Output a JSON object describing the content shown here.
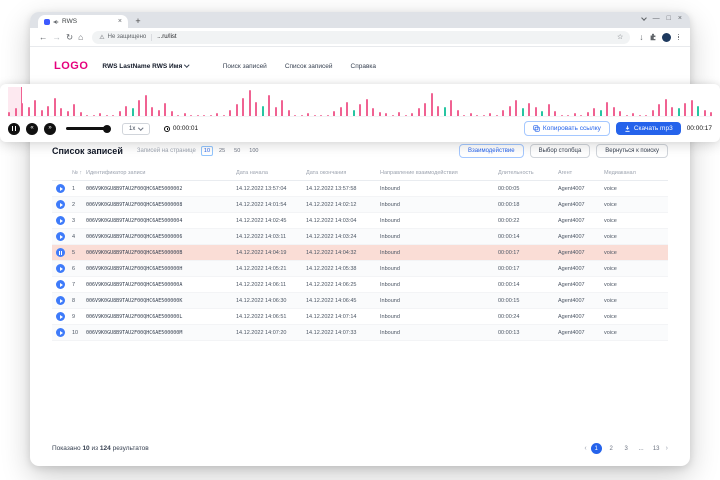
{
  "browser": {
    "tab_title": "RWS",
    "security_label": "Не защищено",
    "url": "...ru/list"
  },
  "app": {
    "logo": "LOGO",
    "user_name": "RWS LastName RWS Имя",
    "nav": [
      "Поиск записей",
      "Список записей",
      "Справка"
    ]
  },
  "player": {
    "speed": "1x",
    "current_time": "00:00:01",
    "total_time": "00:00:17",
    "copy_link_label": "Копировать ссылку",
    "download_label": "Скачать mp3",
    "progress_pct": 2,
    "colors": {
      "wave_pink": "#F06292",
      "wave_teal": "#26C6A2",
      "accent_blue": "#2563EB"
    },
    "waveform": [
      3,
      6,
      10,
      7,
      12,
      5,
      8,
      14,
      6,
      4,
      9,
      3,
      1,
      1,
      2,
      1,
      1,
      4,
      8,
      -6,
      12,
      16,
      7,
      5,
      10,
      4,
      1,
      2,
      1,
      1,
      1,
      1,
      2,
      1,
      5,
      9,
      14,
      20,
      11,
      -8,
      16,
      7,
      12,
      5,
      1,
      1,
      2,
      1,
      1,
      1,
      4,
      7,
      11,
      -5,
      9,
      13,
      6,
      3,
      2,
      1,
      3,
      1,
      2,
      6,
      10,
      18,
      8,
      -7,
      12,
      5,
      1,
      2,
      1,
      1,
      2,
      1,
      5,
      8,
      12,
      -6,
      10,
      7,
      -4,
      9,
      4,
      1,
      1,
      2,
      1,
      3,
      6,
      -5,
      11,
      7,
      4,
      1,
      2,
      1,
      1,
      5,
      9,
      13,
      7,
      -6,
      10,
      12,
      -8,
      5,
      3
    ]
  },
  "list": {
    "title": "Список записей",
    "page_size_label": "Записей на странице",
    "page_sizes": [
      "10",
      "25",
      "50",
      "100"
    ],
    "active_page_size": "10",
    "sort_icon": "↑",
    "actions": [
      "Взаимодействие",
      "Выбор столбца",
      "Вернуться к поиску"
    ],
    "columns": [
      "№",
      "Идентификатор записи",
      "Дата начала",
      "Дата окончания",
      "Направление взаимодействия",
      "Длительность",
      "Агент",
      "Медиаканал"
    ],
    "rows": [
      {
        "n": "1",
        "id": "006V9K0GU8B9TAU2F00QHC6AE5000002",
        "start": "14.12.2022 13:57:04",
        "end": "14.12.2022 13:57:58",
        "direction": "Inbound",
        "duration": "00:00:05",
        "agent": "Agent4007",
        "channel": "voice",
        "playing": false
      },
      {
        "n": "2",
        "id": "006V9K0GU8B9TAU2F00QHC6AE5000008",
        "start": "14.12.2022 14:01:54",
        "end": "14.12.2022 14:02:12",
        "direction": "Inbound",
        "duration": "00:00:18",
        "agent": "Agent4007",
        "channel": "voice",
        "playing": false
      },
      {
        "n": "3",
        "id": "006V9K0GU8B9TAU2F00QHC6AE5000004",
        "start": "14.12.2022 14:02:45",
        "end": "14.12.2022 14:03:04",
        "direction": "Inbound",
        "duration": "00:00:22",
        "agent": "Agent4007",
        "channel": "voice",
        "playing": false
      },
      {
        "n": "4",
        "id": "006V9K0GU8B9TAU2F00QHC6AE5000006",
        "start": "14.12.2022 14:03:11",
        "end": "14.12.2022 14:03:24",
        "direction": "Inbound",
        "duration": "00:00:14",
        "agent": "Agent4007",
        "channel": "voice",
        "playing": false
      },
      {
        "n": "5",
        "id": "006V9K0GU8B9TAU2F00QHC6AE500000B",
        "start": "14.12.2022 14:04:19",
        "end": "14.12.2022 14:04:32",
        "direction": "Inbound",
        "duration": "00:00:17",
        "agent": "Agent4007",
        "channel": "voice",
        "playing": true
      },
      {
        "n": "6",
        "id": "006V9K0GU8B9TAU2F00QHC6AE500000H",
        "start": "14.12.2022 14:05:21",
        "end": "14.12.2022 14:05:38",
        "direction": "Inbound",
        "duration": "00:00:17",
        "agent": "Agent4007",
        "channel": "voice",
        "playing": false
      },
      {
        "n": "7",
        "id": "006V9K0GU8B9TAU2F00QHC6AE500000A",
        "start": "14.12.2022 14:06:11",
        "end": "14.12.2022 14:06:25",
        "direction": "Inbound",
        "duration": "00:00:14",
        "agent": "Agent4007",
        "channel": "voice",
        "playing": false
      },
      {
        "n": "8",
        "id": "006V9K0GU8B9TAU2F00QHC6AE500000K",
        "start": "14.12.2022 14:06:30",
        "end": "14.12.2022 14:06:45",
        "direction": "Inbound",
        "duration": "00:00:15",
        "agent": "Agent4007",
        "channel": "voice",
        "playing": false
      },
      {
        "n": "9",
        "id": "006V9K0GU8B9TAU2F00QHC6AE500000L",
        "start": "14.12.2022 14:06:51",
        "end": "14.12.2022 14:07:14",
        "direction": "Inbound",
        "duration": "00:00:24",
        "agent": "Agent4007",
        "channel": "voice",
        "playing": false
      },
      {
        "n": "10",
        "id": "006V9K0GU8B9TAU2F00QHC6AE500000M",
        "start": "14.12.2022 14:07:20",
        "end": "14.12.2022 14:07:33",
        "direction": "Inbound",
        "duration": "00:00:13",
        "agent": "Agent4007",
        "channel": "voice",
        "playing": false
      }
    ],
    "summary": {
      "prefix": "Показано",
      "shown": "10",
      "infix": "из",
      "total": "124",
      "suffix": "результатов"
    },
    "pagination": {
      "prev": "‹",
      "pages": [
        "1",
        "2",
        "3",
        "...",
        "13"
      ],
      "active": "1",
      "next": "›"
    }
  }
}
